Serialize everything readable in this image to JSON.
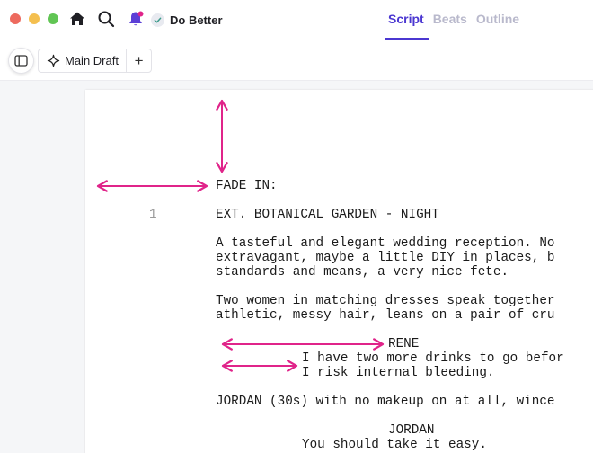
{
  "topbar": {
    "project_name": "Do Better",
    "tabs": [
      {
        "label": "Script",
        "active": true
      },
      {
        "label": "Beats",
        "active": false
      },
      {
        "label": "Outline",
        "active": false
      }
    ]
  },
  "toolbar": {
    "draft_label": "Main Draft",
    "add_label": "+"
  },
  "script": {
    "transition": "FADE IN:",
    "scene_number": "1",
    "scene_heading": "EXT. BOTANICAL GARDEN - NIGHT",
    "action1": [
      "A tasteful and elegant wedding reception. No",
      "extravagant, maybe a little DIY in places, b",
      "standards and means, a very nice fete."
    ],
    "action2": [
      "Two women in matching dresses speak together",
      "athletic, messy hair, leans on a pair of cru"
    ],
    "character1": "RENE",
    "dialogue1": [
      "I have two more drinks to go befor",
      "I risk internal bleeding."
    ],
    "action3": "JORDAN (30s) with no makeup on at all, wince",
    "character2": "JORDAN",
    "dialogue2": "You should take it easy."
  },
  "colors": {
    "accent": "#4b37d1",
    "guide_arrows": "#e0248a",
    "bell": "#5b3fd6"
  }
}
